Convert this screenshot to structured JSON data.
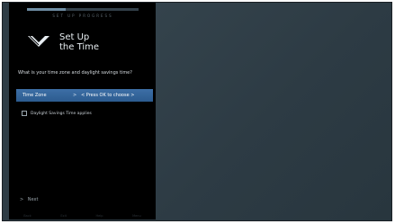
{
  "setup": {
    "progress_label": "SET UP PROGRESS",
    "progress": 0.35,
    "title_line1": "Set Up",
    "title_line2": "the Time",
    "question": "What is your time zone and daylight savings time?",
    "time_zone_label": "Time Zone",
    "time_zone_arrow": ">",
    "time_zone_value": "< Press OK to choose >",
    "dst_label": "Daylight Savings Time applies",
    "next_arrow": ">",
    "next_label": "Next",
    "bottom_labels": [
      "Back",
      "Exit",
      "Help",
      "Menu"
    ]
  },
  "icons": {
    "logo": "vizio-v-logo",
    "checkbox": "checkbox-unchecked"
  },
  "colors": {
    "panel_bg": "#000000",
    "tv_bg": "#2f3d46",
    "highlight": "#2f6196",
    "progress_fill": "#6f8ea4"
  }
}
